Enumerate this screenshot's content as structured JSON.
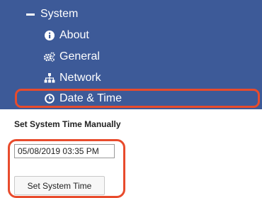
{
  "nav": {
    "items": [
      {
        "label": "System",
        "icon": "minus-icon"
      },
      {
        "label": "About",
        "icon": "info-circle-icon"
      },
      {
        "label": "General",
        "icon": "cogs-icon"
      },
      {
        "label": "Network",
        "icon": "sitemap-icon"
      },
      {
        "label": "Date & Time",
        "icon": "clock-icon"
      }
    ]
  },
  "form": {
    "section_title": "Set System Time Manually",
    "datetime_value": "05/08/2019 03:35 PM",
    "button_label": "Set System Time"
  },
  "colors": {
    "nav_background": "#3d5a98",
    "highlight": "#e84b2c"
  }
}
